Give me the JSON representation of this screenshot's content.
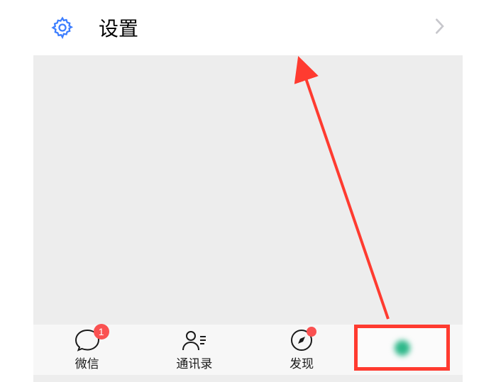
{
  "settings": {
    "label": "设置",
    "icon_name": "gear-icon"
  },
  "tabs": [
    {
      "id": "wechat",
      "label": "微信",
      "icon": "chat",
      "badge": "1"
    },
    {
      "id": "contacts",
      "label": "通讯录",
      "icon": "contact"
    },
    {
      "id": "discover",
      "label": "发现",
      "icon": "compass",
      "dot": true
    },
    {
      "id": "me",
      "label": "",
      "icon": "me"
    }
  ],
  "colors": {
    "accent": "#3d7eff",
    "badge": "#fa5151",
    "annotation": "#ff3b30"
  }
}
